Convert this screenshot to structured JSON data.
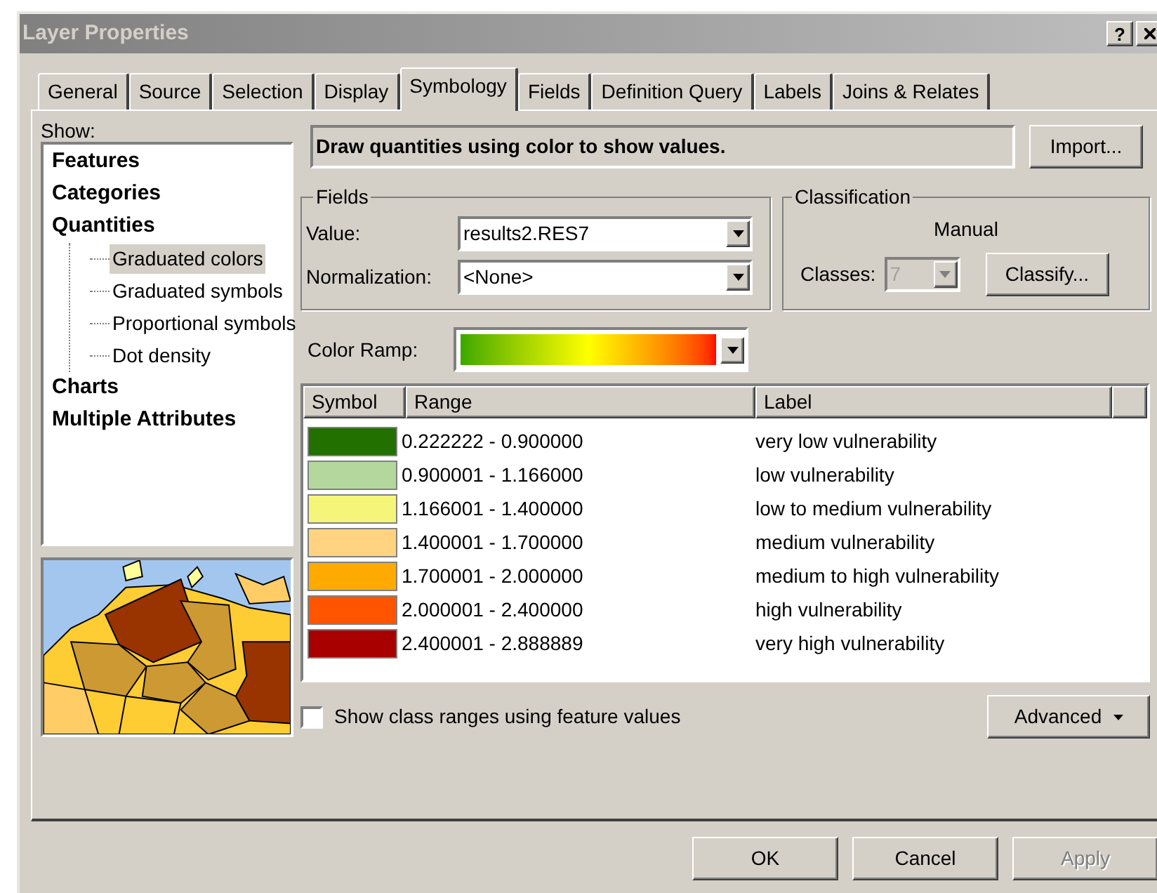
{
  "window": {
    "title": "Layer Properties",
    "help_button": "?"
  },
  "tabs": [
    {
      "label": "General",
      "selected": false
    },
    {
      "label": "Source",
      "selected": false
    },
    {
      "label": "Selection",
      "selected": false
    },
    {
      "label": "Display",
      "selected": false
    },
    {
      "label": "Symbology",
      "selected": true
    },
    {
      "label": "Fields",
      "selected": false
    },
    {
      "label": "Definition Query",
      "selected": false
    },
    {
      "label": "Labels",
      "selected": false
    },
    {
      "label": "Joins & Relates",
      "selected": false
    }
  ],
  "show": {
    "label": "Show:",
    "tree": [
      {
        "label": "Features",
        "selected": false
      },
      {
        "label": "Categories",
        "selected": false
      },
      {
        "label": "Quantities",
        "selected": false,
        "children": [
          {
            "label": "Graduated colors",
            "selected": true
          },
          {
            "label": "Graduated symbols",
            "selected": false
          },
          {
            "label": "Proportional symbols",
            "selected": false
          },
          {
            "label": "Dot density",
            "selected": false
          }
        ]
      },
      {
        "label": "Charts",
        "selected": false
      },
      {
        "label": "Multiple Attributes",
        "selected": false
      }
    ]
  },
  "description": "Draw quantities using color to show values.",
  "import_button": "Import...",
  "fields": {
    "title": "Fields",
    "rows": [
      {
        "label": "Value:",
        "value": "results2.RES7"
      },
      {
        "label": "Normalization:",
        "value": "<None>"
      }
    ]
  },
  "classification": {
    "title": "Classification",
    "method": "Manual",
    "classes_label": "Classes:",
    "classes_value": "7",
    "classes_disabled": true,
    "classify_button": "Classify..."
  },
  "color_ramp": {
    "label": "Color Ramp:"
  },
  "table": {
    "columns": [
      "Symbol",
      "Range",
      "Label"
    ],
    "rows": [
      {
        "color": "#217000",
        "range": "0.222222 - 0.900000",
        "label": "very low vulnerability"
      },
      {
        "color": "#b4d79e",
        "range": "0.900001 - 1.166000",
        "label": "low vulnerability"
      },
      {
        "color": "#f5f57a",
        "range": "1.166001 - 1.400000",
        "label": "low to medium vulnerability"
      },
      {
        "color": "#ffd37f",
        "range": "1.400001 - 1.700000",
        "label": "medium vulnerability"
      },
      {
        "color": "#ffaa00",
        "range": "1.700001 - 2.000000",
        "label": "medium to high vulnerability"
      },
      {
        "color": "#ff5500",
        "range": "2.000001 - 2.400000",
        "label": "high vulnerability"
      },
      {
        "color": "#a80000",
        "range": "2.400001 - 2.888889",
        "label": "very high vulnerability"
      }
    ]
  },
  "feature_values": {
    "label": "Show class ranges using feature values",
    "checked": false
  },
  "advanced_button": "Advanced",
  "buttons": [
    {
      "label": "OK",
      "disabled": false
    },
    {
      "label": "Cancel",
      "disabled": false
    },
    {
      "label": "Apply",
      "disabled": true
    }
  ]
}
